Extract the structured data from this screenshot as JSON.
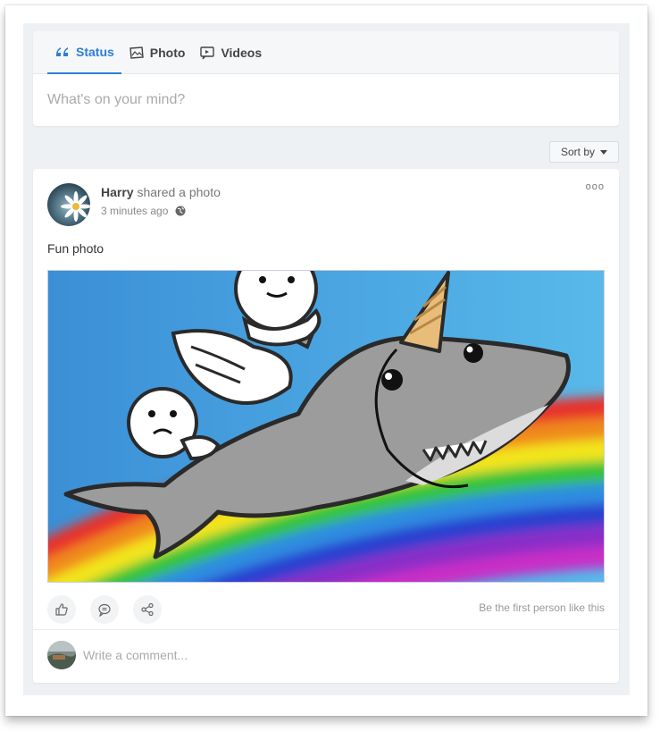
{
  "composer": {
    "tabs": [
      {
        "label": "Status",
        "icon": "quote-icon",
        "active": true
      },
      {
        "label": "Photo",
        "icon": "photo-icon",
        "active": false
      },
      {
        "label": "Videos",
        "icon": "video-icon",
        "active": false
      }
    ],
    "placeholder": "What's on your mind?"
  },
  "sort": {
    "label": "Sort by"
  },
  "post": {
    "author": "Harry",
    "action": "shared a photo",
    "time": "3 minutes ago",
    "more": "ooo",
    "text": "Fun photo",
    "like_note": "Be the first person like this",
    "comment_placeholder": "Write a comment..."
  },
  "colors": {
    "accent": "#2d7fd6",
    "feed_bg": "#eef1f4",
    "sky": "#4aaee8"
  }
}
